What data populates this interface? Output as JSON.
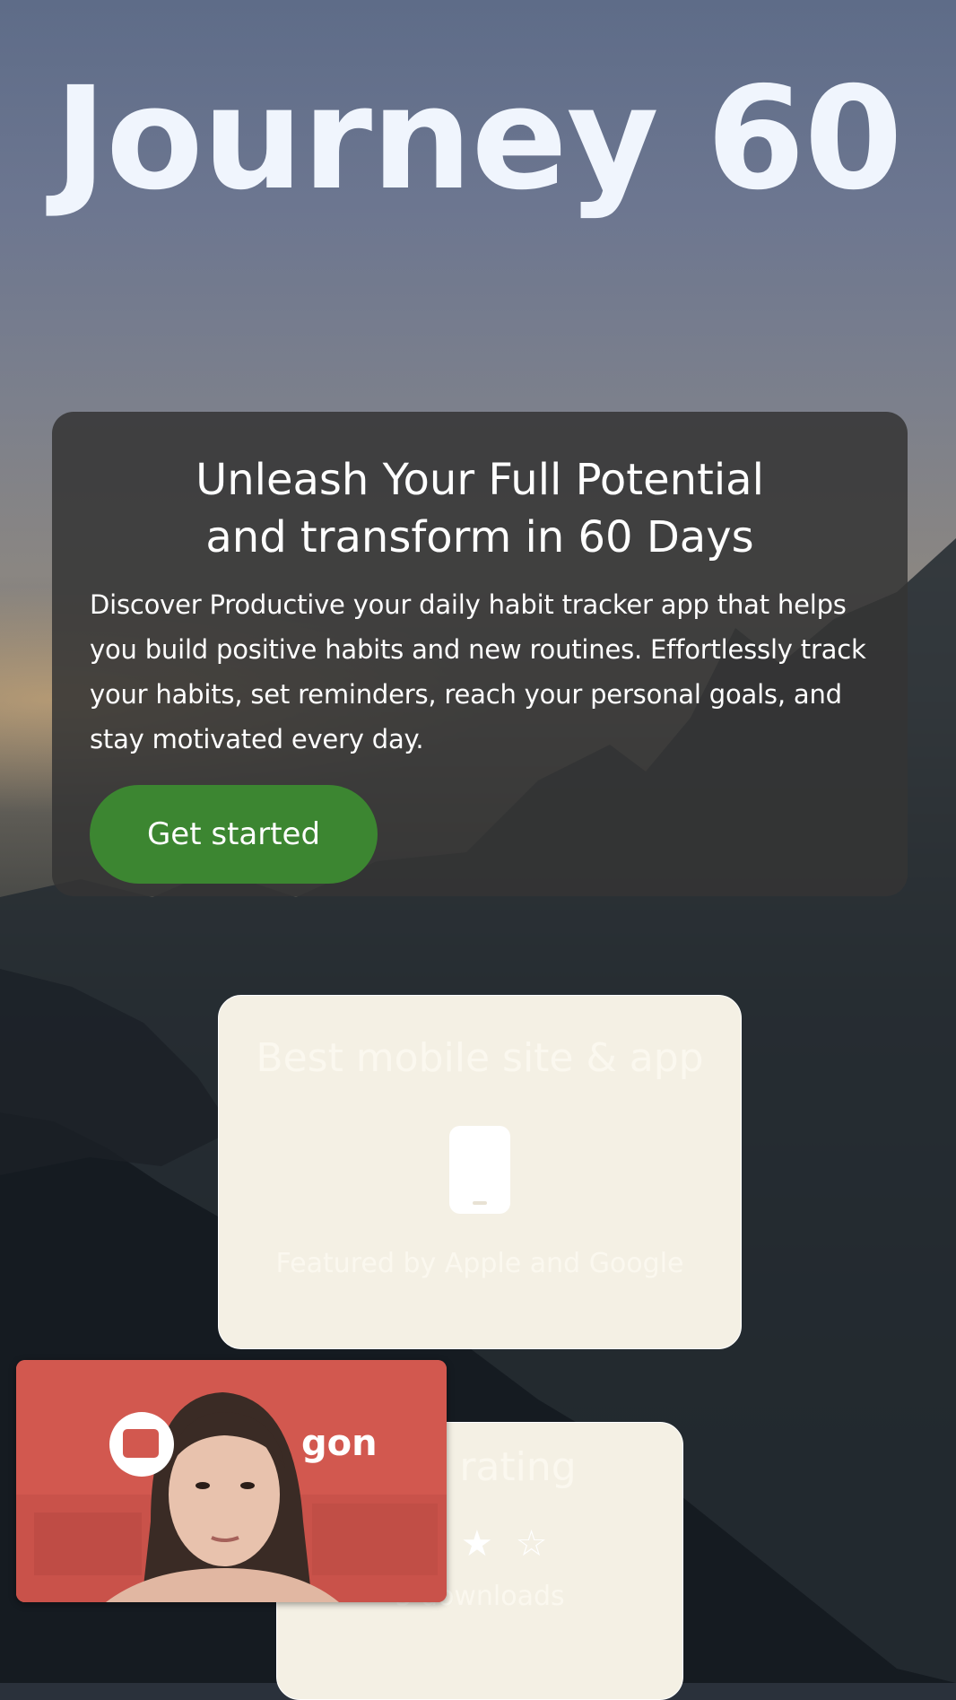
{
  "app": {
    "title": "Journey 60"
  },
  "hero": {
    "heading_line1": "Unleash Your Full Potential",
    "heading_line2": "and transform in 60 Days",
    "description": "Discover Productive your daily habit tracker app that helps you build positive habits and new routines. Effortlessly track your habits, set reminders, reach your personal goals, and stay motivated every day.",
    "cta_label": "Get started"
  },
  "cards": [
    {
      "title": "Best mobile site & app",
      "icon": "phone-icon",
      "subtitle": "Featured by Apple and Google"
    },
    {
      "title": "ore rating",
      "icon": "star-icon",
      "stars_display": "★ ★ ☆",
      "subtitle": "3 downloads"
    }
  ],
  "video_overlay": {
    "brand_text": "gon"
  },
  "colors": {
    "title": "#f0f5fd",
    "hero_bg": "#343434",
    "cta_bg": "#3c8631",
    "card_bg": "#f4f0e4",
    "video_bg": "#d2584f"
  }
}
